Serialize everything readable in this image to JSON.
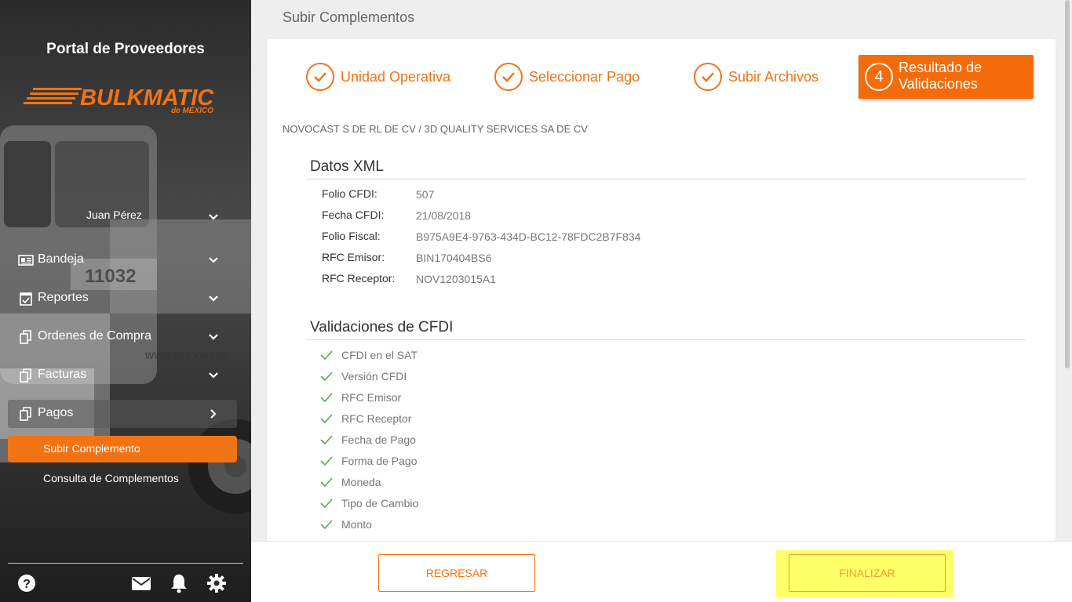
{
  "sidebar": {
    "portal_title": "Portal de Proveedores",
    "logo_text": "BULKMATIC",
    "logo_subtext": "de MÉXICO",
    "truck_number": "11032",
    "truck_url_text": "WWW.BULKMATIC",
    "user_name": "Juan Pérez",
    "nav": [
      {
        "label": "Bandeja",
        "icon": "newspaper-icon"
      },
      {
        "label": "Reportes",
        "icon": "calendar-check-icon"
      },
      {
        "label": "Ordenes de Compra",
        "icon": "copy-icon"
      },
      {
        "label": "Facturas",
        "icon": "copy-icon"
      },
      {
        "label": "Pagos",
        "icon": "copy-icon"
      }
    ],
    "subnav": [
      {
        "label": "Subir Complemento",
        "active": true
      },
      {
        "label": "Consulta de Complementos",
        "active": false
      }
    ],
    "footer_icons": [
      "help-icon",
      "mail-icon",
      "bell-icon",
      "gear-icon"
    ]
  },
  "main": {
    "page_title": "Subir Complementos",
    "steps": [
      {
        "label": "Unidad Operativa",
        "done": true
      },
      {
        "label": "Seleccionar Pago",
        "done": true
      },
      {
        "label": "Subir Archivos",
        "done": true
      },
      {
        "number": "4",
        "label": "Resultado de Validaciones",
        "active": true
      }
    ],
    "company": "NOVOCAST S DE RL DE CV / 3D QUALITY SERVICES SA DE CV",
    "xml_title": "Datos XML",
    "xml_fields": [
      {
        "label": "Folio CFDI:",
        "value": "507"
      },
      {
        "label": "Fecha CFDI:",
        "value": "21/08/2018"
      },
      {
        "label": "Folio Fiscal:",
        "value": "B975A9E4-9763-434D-BC12-78FDC2B7F834"
      },
      {
        "label": "RFC Emisor:",
        "value": "BIN170404BS6"
      },
      {
        "label": "RFC Receptor:",
        "value": "NOV1203015A1"
      }
    ],
    "validations_title": "Validaciones de CFDI",
    "validations": [
      "CFDI en el SAT",
      "Versión CFDI",
      "RFC Emisor",
      "RFC Receptor",
      "Fecha de Pago",
      "Forma de Pago",
      "Moneda",
      "Tipo de Cambio",
      "Monto"
    ]
  },
  "footer": {
    "back_label": "REGRESAR",
    "finish_label": "FINALIZAR"
  },
  "colors": {
    "accent": "#f27313",
    "check_green": "#4caf50",
    "highlight": "#ffff66"
  }
}
